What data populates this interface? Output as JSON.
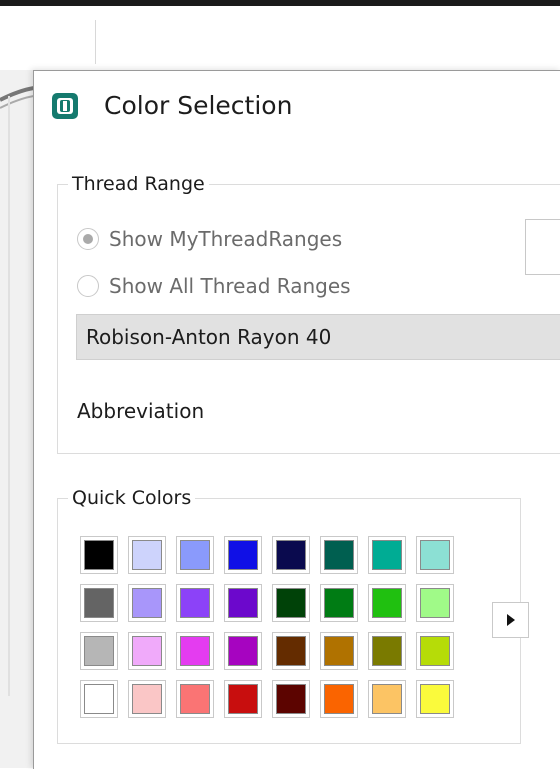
{
  "dialog": {
    "title": "Color Selection",
    "icon": "thread-spool-icon"
  },
  "thread_range": {
    "group_title": "Thread Range",
    "options": [
      {
        "label": "Show MyThreadRanges",
        "selected": true
      },
      {
        "label": "Show All Thread Ranges",
        "selected": false
      }
    ],
    "selected_range": "Robison-Anton Rayon 40",
    "abbreviation_label": "Abbreviation"
  },
  "quick_colors": {
    "group_title": "Quick Colors",
    "more_icon": "triangle-right-icon",
    "rows": [
      [
        "#000000",
        "#cdd3fc",
        "#8a9afc",
        "#1010e6",
        "#0a0a4e",
        "#005f50",
        "#00ac94",
        "#8ce0d4"
      ],
      [
        "#646464",
        "#a896fa",
        "#8c42f8",
        "#6c08cc",
        "#004208",
        "#007c14",
        "#20c010",
        "#a0fa88"
      ],
      [
        "#b6b6b6",
        "#f0aafa",
        "#e43cf0",
        "#a604c0",
        "#642c00",
        "#b07200",
        "#7a7a00",
        "#b6dc08"
      ],
      [
        "#ffffff",
        "#fac6c6",
        "#fa7474",
        "#c80e0e",
        "#5c0400",
        "#fa6400",
        "#fcc464",
        "#fafa3c"
      ]
    ]
  }
}
